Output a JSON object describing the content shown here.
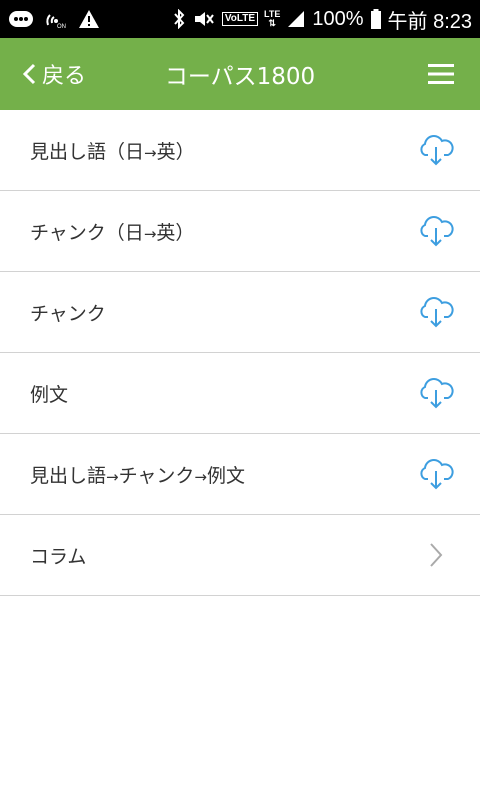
{
  "status_bar": {
    "battery_text": "100%",
    "time": "午前 8:23",
    "volte": "VoLTE",
    "lte": "LTE"
  },
  "app_bar": {
    "back_label": "戻る",
    "title": "コーパス1800",
    "menu_icon": "hamburger-menu-icon"
  },
  "colors": {
    "app_bar": "#74b04a",
    "cloud_icon": "#3d9ee0",
    "chevron": "#aaaaaa"
  },
  "items": [
    {
      "parts": [
        "見出し語（日",
        "→",
        "英）"
      ],
      "icon": "cloud-download-icon"
    },
    {
      "parts": [
        "チャンク（日",
        "→",
        "英）"
      ],
      "icon": "cloud-download-icon"
    },
    {
      "parts": [
        "チャンク"
      ],
      "icon": "cloud-download-icon"
    },
    {
      "parts": [
        "例文"
      ],
      "icon": "cloud-download-icon"
    },
    {
      "parts": [
        "見出し語",
        "→",
        "チャンク",
        "→",
        "例文"
      ],
      "icon": "cloud-download-icon"
    },
    {
      "parts": [
        "コラム"
      ],
      "icon": "chevron-right-icon"
    }
  ]
}
